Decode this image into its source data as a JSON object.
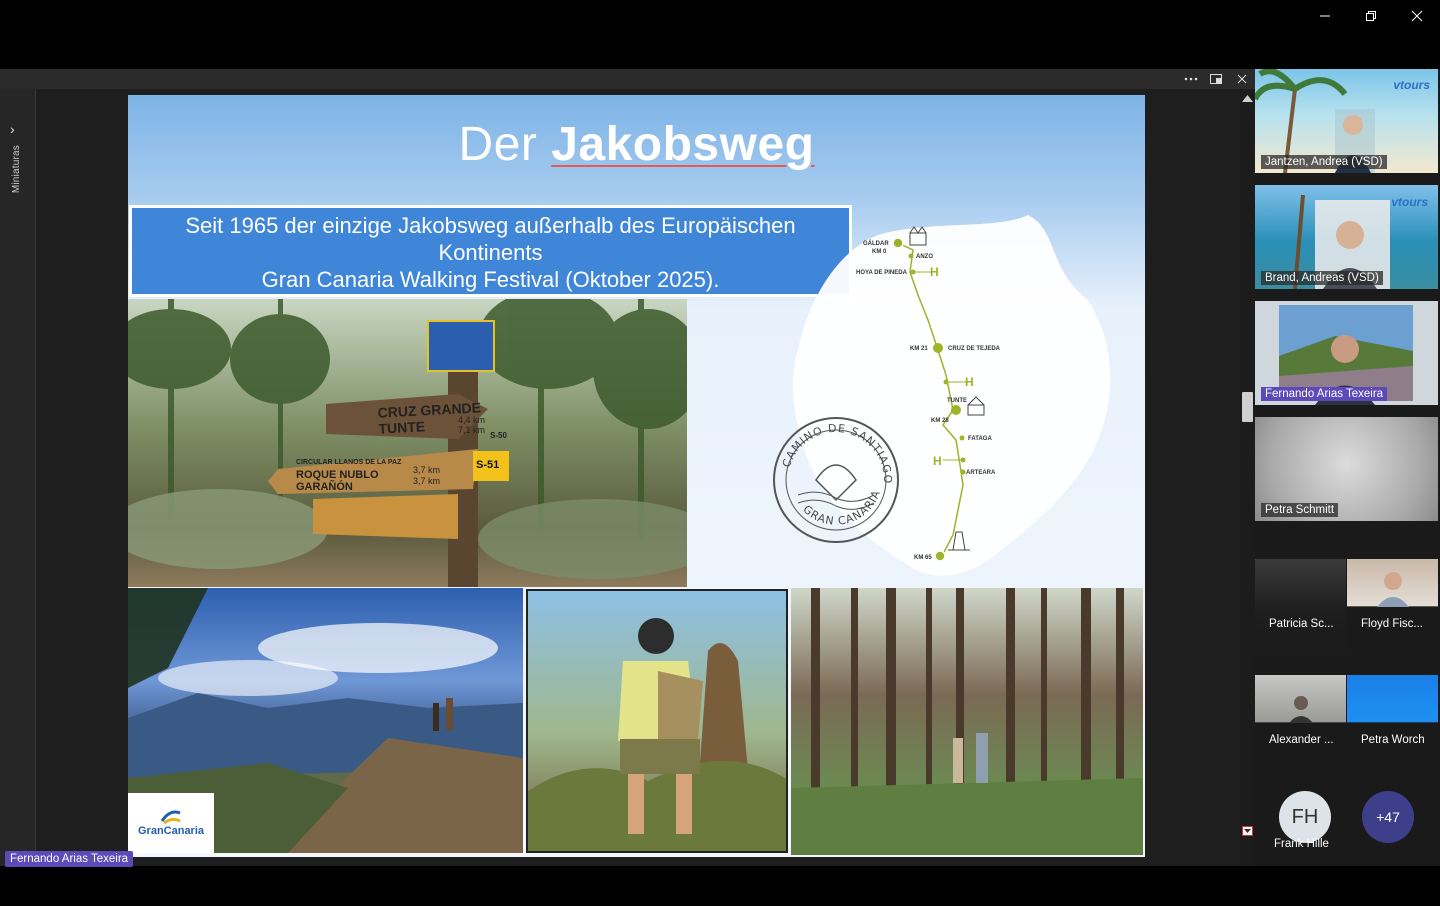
{
  "window": {
    "minimize_icon": "minimize-icon",
    "maximize_icon": "restore-icon",
    "close_icon": "close-icon"
  },
  "stage": {
    "toolbar": {
      "more_icon": "more-icon",
      "popout_icon": "popout-icon",
      "close_icon": "close-icon"
    },
    "sidebar": {
      "label": "Miniaturas",
      "toggle_icon": "chevron-right-icon"
    },
    "presenter_name": "Fernando Arias Texeira"
  },
  "slide": {
    "title_prefix": "Der ",
    "title_bold": "Jakobsweg",
    "subtitle_lines": [
      "Seit 1965 der einzige Jakobsweg außerhalb des Europäischen",
      "Kontinents",
      "Gran Canaria Walking Festival (Oktober 2025)."
    ],
    "sign": {
      "line1": "CRUZ GRANDE",
      "line2": "TUNTE",
      "dist1": "4,4 km",
      "dist2": "7,1 km",
      "code1": "S-50",
      "line3": "CIRCULAR LLANOS DE LA PAZ",
      "line4": "ROQUE NUBLO",
      "line5": "GARAÑÓN",
      "dist3": "3,7 km",
      "dist4": "3,7 km",
      "code2": "S-51"
    },
    "map": {
      "labels": {
        "galdar": "GÁLDAR",
        "km0": "KM 0",
        "anzo": "ANZO",
        "hoya": "HOYA DE PINEDA",
        "km21": "KM 21",
        "cruz": "CRUZ DE TEJEDA",
        "tunte": "TUNTE",
        "km28": "KM 28",
        "fataga": "FATAGA",
        "arteara": "ARTEARA",
        "km65": "KM 65",
        "h1": "H",
        "h2": "H",
        "h3": "H"
      },
      "stamp_top": "CAMINO DE SANTIAGO",
      "stamp_bottom": "GRAN CANARIA",
      "route_color": "#9bb52a"
    },
    "logo": "GranCanaria"
  },
  "participants": [
    {
      "name": "Jantzen, Andrea (VSD)",
      "brand": "vtours"
    },
    {
      "name": "Brand, Andreas (VSD)",
      "brand": "vtours"
    },
    {
      "name": "Fernando Arias Texeira",
      "active": true
    },
    {
      "name": "Petra Schmitt"
    },
    {
      "name": "Patricia Sc..."
    },
    {
      "name": "Floyd Fisc..."
    },
    {
      "name": "Alexander ..."
    },
    {
      "name": "Petra Worch"
    },
    {
      "name": "Frank Hille",
      "initials": "FH"
    },
    {
      "overflow": "+47"
    }
  ],
  "colors": {
    "accent": "#5b4ab8",
    "slide_box": "#3f86d8"
  }
}
